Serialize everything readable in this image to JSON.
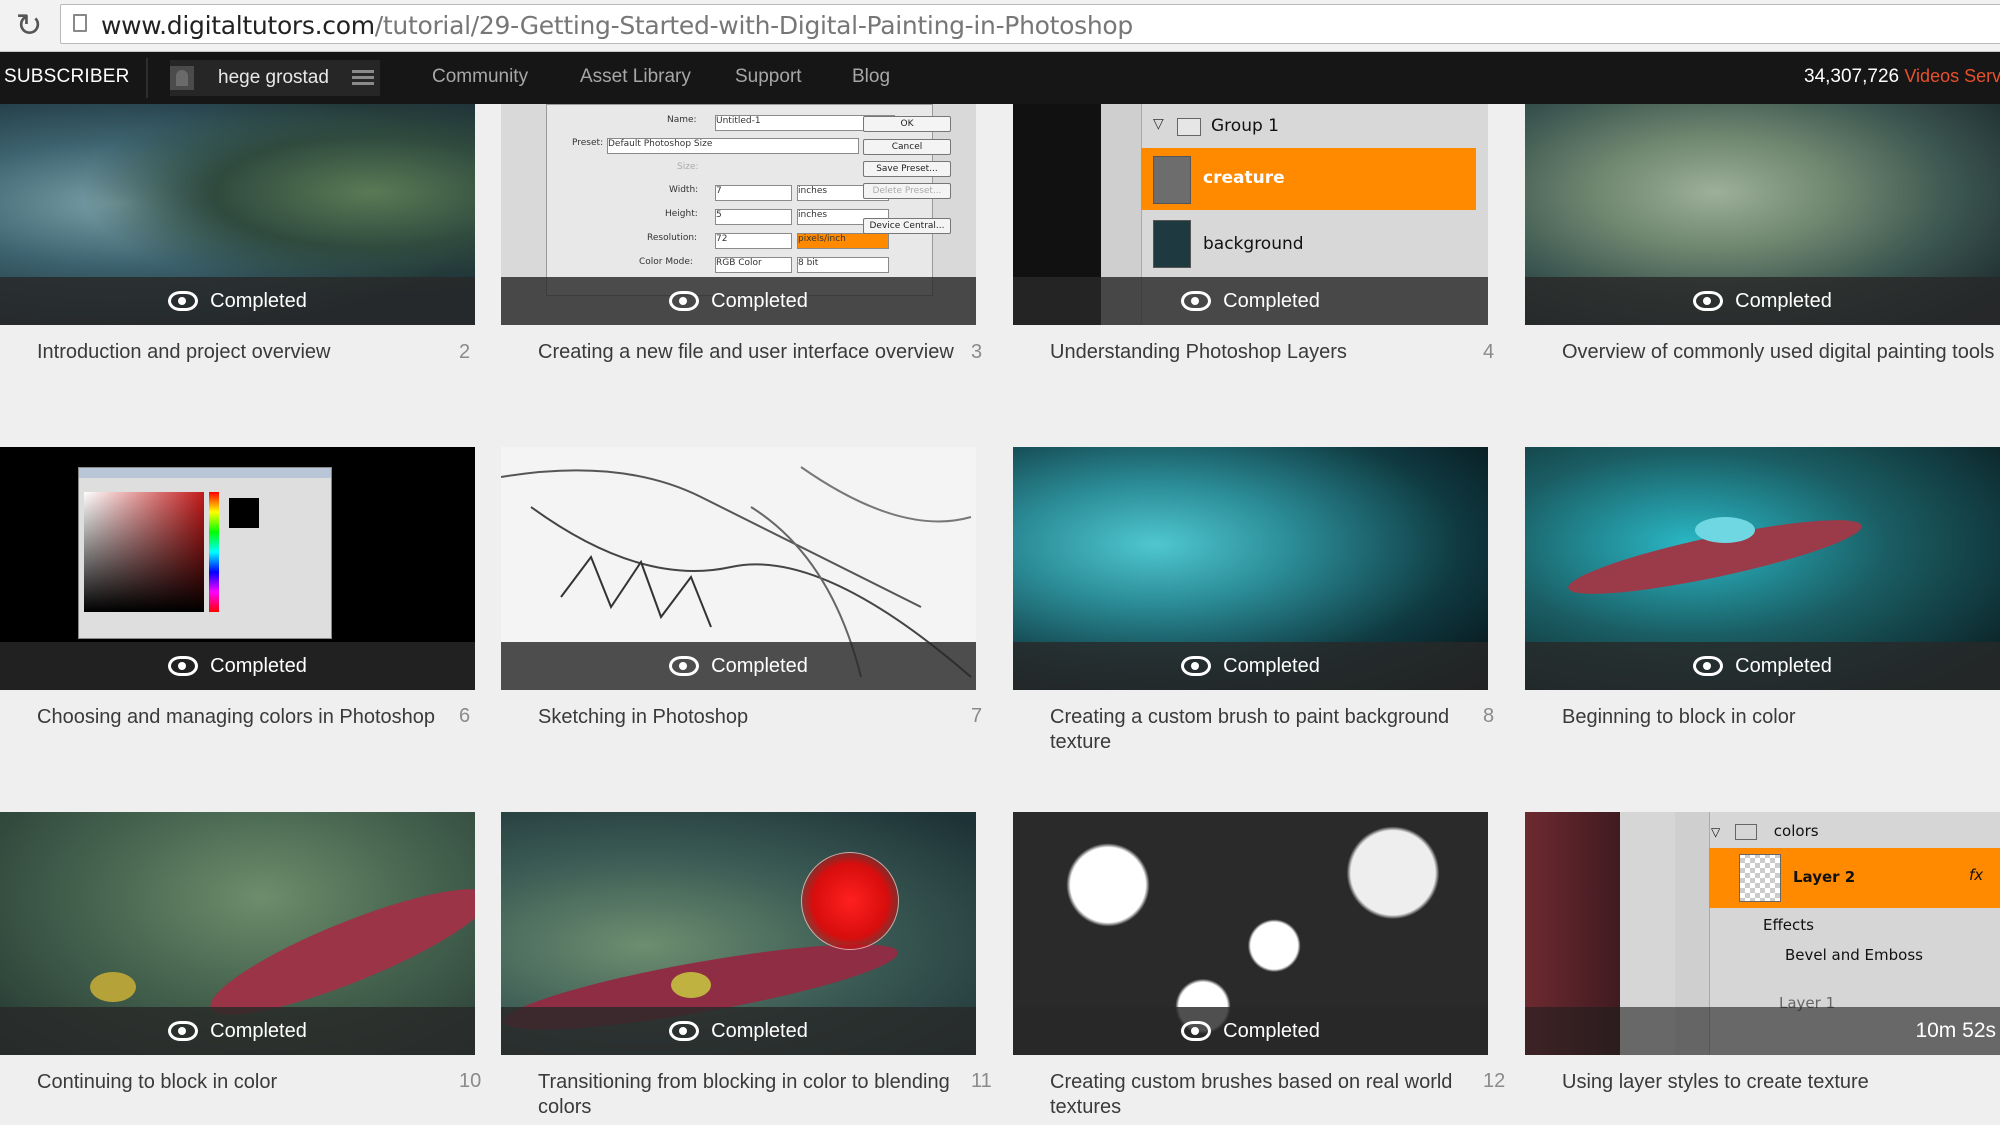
{
  "browser": {
    "url_host": "www.digitaltutors.com",
    "url_path": "/tutorial/29-Getting-Started-with-Digital-Painting-in-Photoshop"
  },
  "nav": {
    "subscriber": "SUBSCRIBER",
    "username": "hege grostad",
    "links": [
      "Community",
      "Asset Library",
      "Support",
      "Blog"
    ],
    "count": "34,307,726",
    "count_suffix": "Videos Serv"
  },
  "colors": {
    "accent": "#ff8a00",
    "nav_bg": "#161616",
    "counter_red": "#e8502c"
  },
  "status_label": "Completed",
  "tiles": [
    {
      "num": "",
      "title": "Introduction and project overview"
    },
    {
      "num": "2",
      "title": "Creating a new file and user interface overview"
    },
    {
      "num": "3",
      "title": "Understanding Photoshop Layers"
    },
    {
      "num": "4",
      "title": "Overview of commonly used digital painting tools"
    },
    {
      "num": "",
      "title": "Choosing and managing colors in Photoshop"
    },
    {
      "num": "6",
      "title": "Sketching in Photoshop"
    },
    {
      "num": "7",
      "title": "Creating a custom brush to paint background texture"
    },
    {
      "num": "8",
      "title": "Beginning to block in color"
    },
    {
      "num": "",
      "title": "Continuing to block in color"
    },
    {
      "num": "10",
      "title": "Transitioning from blocking in color to blending colors"
    },
    {
      "num": "11",
      "title": "Creating custom brushes based on real world textures"
    },
    {
      "num": "12",
      "title": "Using layer styles to create texture"
    }
  ],
  "tile12_duration": "10m 52s",
  "ps_dialog": {
    "name_label": "Name:",
    "name_value": "Untitled-1",
    "preset_label": "Preset:",
    "preset_value": "Default Photoshop Size",
    "size_label": "Size:",
    "width_label": "Width:",
    "width_value": "7",
    "width_unit": "inches",
    "height_label": "Height:",
    "height_value": "5",
    "height_unit": "inches",
    "res_label": "Resolution:",
    "res_value": "72",
    "res_unit": "pixels/inch",
    "mode_label": "Color Mode:",
    "mode_value": "RGB Color",
    "mode_bits": "8 bit",
    "buttons": [
      "OK",
      "Cancel",
      "Save Preset...",
      "Delete Preset...",
      "Device Central..."
    ]
  },
  "layers_panel": {
    "group": "Group 1",
    "creature": "creature",
    "background": "background"
  },
  "layers_panel2": {
    "folder": "colors",
    "layer2": "Layer 2",
    "effects": "Effects",
    "bevel": "Bevel and Emboss",
    "layer1": "Layer 1",
    "fx": "fx"
  }
}
